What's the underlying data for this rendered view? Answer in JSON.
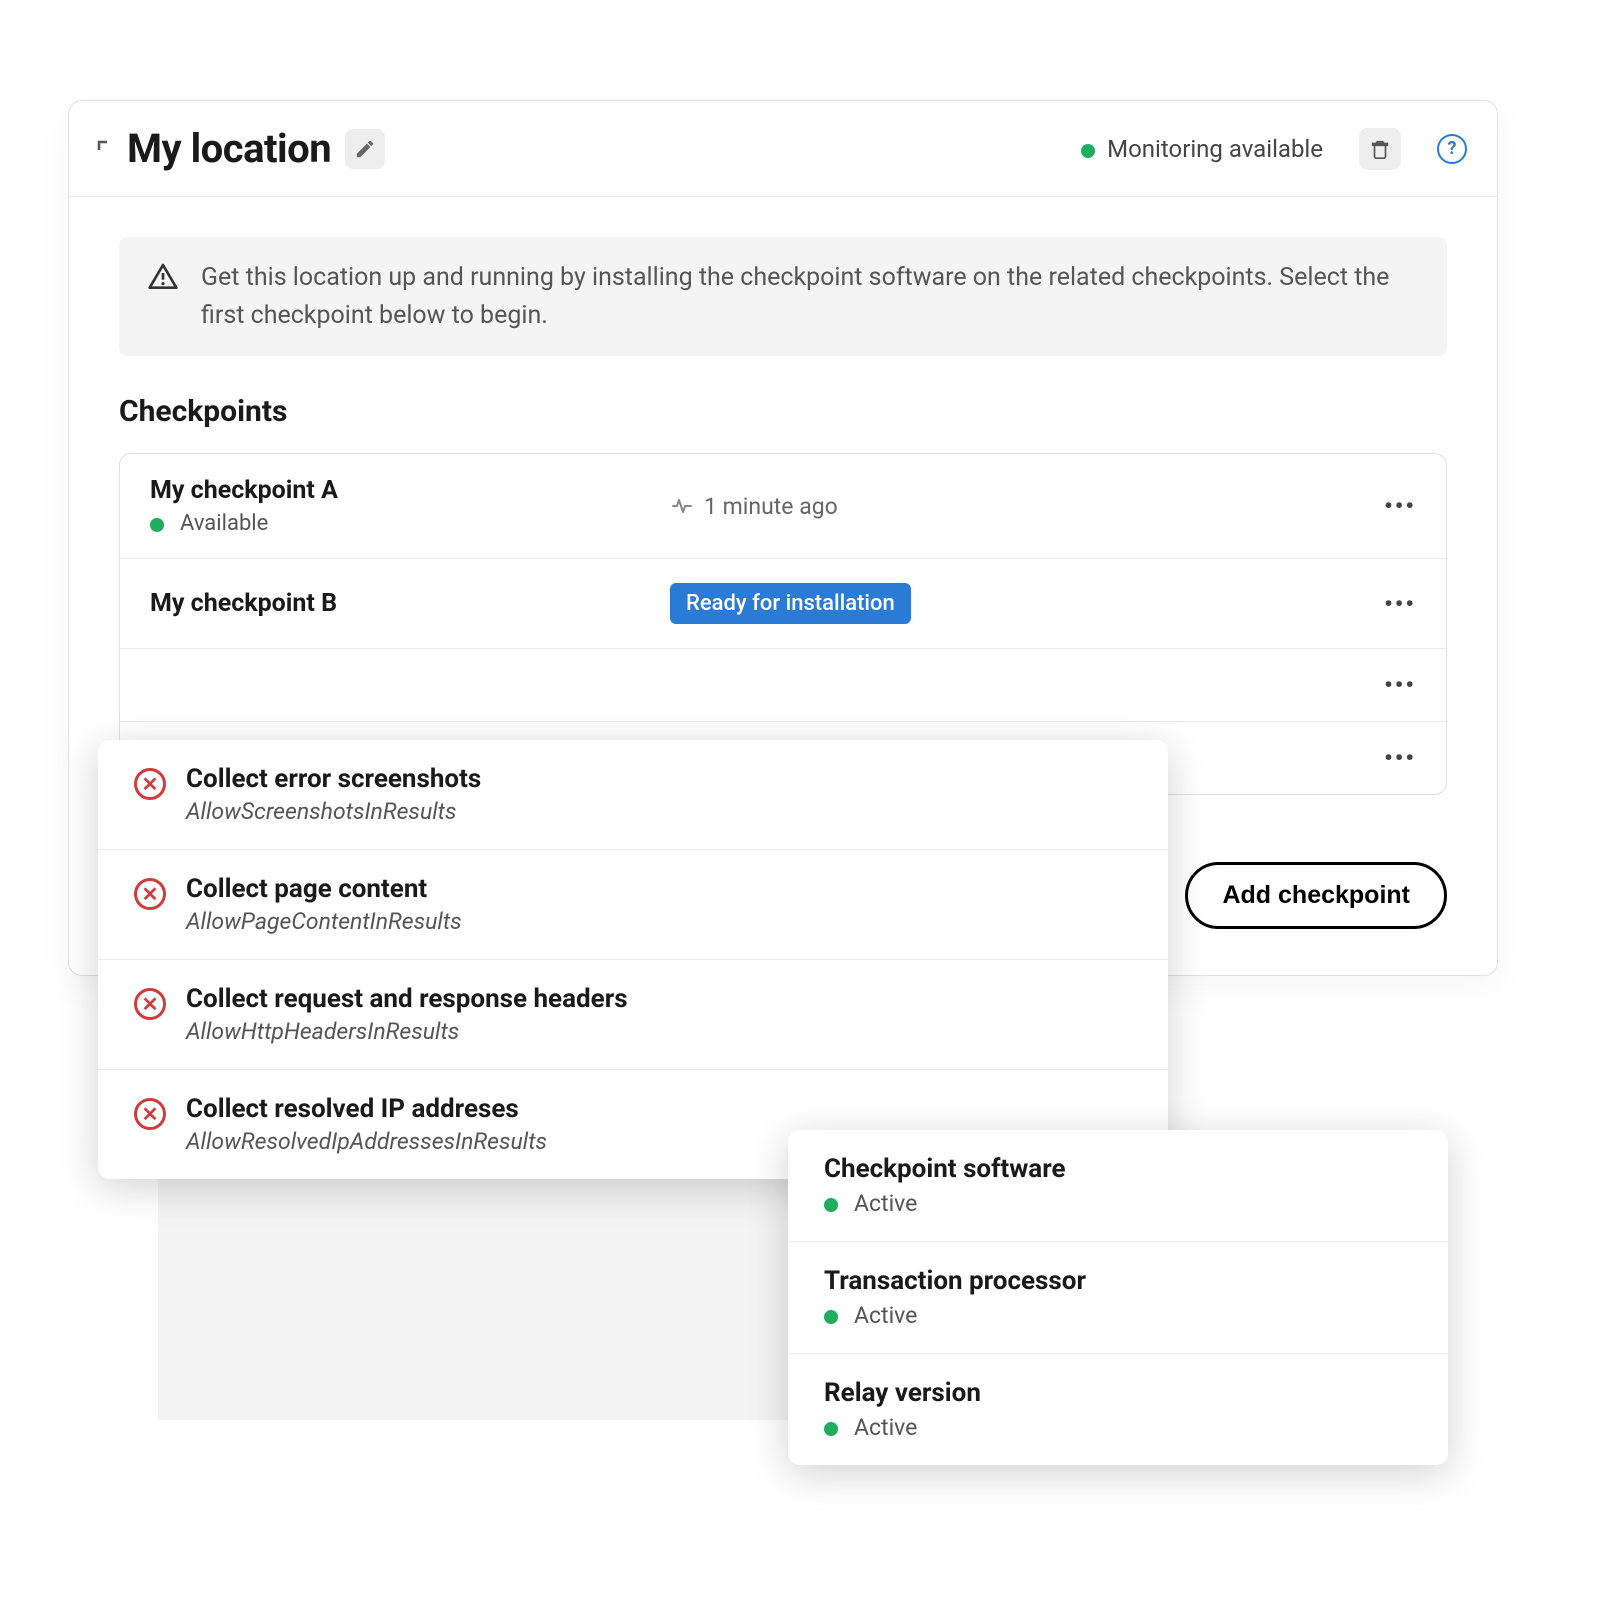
{
  "header": {
    "title": "My location",
    "status": "Monitoring available"
  },
  "banner": {
    "text": "Get this location up and running by installing the checkpoint software on the related checkpoints. Select the first checkpoint below to begin."
  },
  "section_title": "Checkpoints",
  "checkpoints": [
    {
      "name": "My checkpoint A",
      "sub": "Available",
      "mid_text": "1 minute ago",
      "has_dot": true,
      "has_heartbeat": true
    },
    {
      "name": "My checkpoint B",
      "sub": "",
      "mid_badge": "Ready for installation"
    },
    {
      "name": "",
      "sub": ""
    },
    {
      "name": "",
      "sub": ""
    }
  ],
  "add_button": "Add checkpoint",
  "add_button_visible": "d checkpoint",
  "collect": [
    {
      "title": "Collect error screenshots",
      "sub": "AllowScreenshotsInResults"
    },
    {
      "title": "Collect page content",
      "sub": "AllowPageContentInResults"
    },
    {
      "title": "Collect request and response headers",
      "sub": "AllowHttpHeadersInResults"
    },
    {
      "title": "Collect resolved IP addreses",
      "sub": "AllowResolvedIpAddressesInResults"
    }
  ],
  "status_items": [
    {
      "title": "Checkpoint software",
      "sub": "Active"
    },
    {
      "title": "Transaction processor",
      "sub": "Active"
    },
    {
      "title": "Relay version",
      "sub": "Active"
    }
  ]
}
